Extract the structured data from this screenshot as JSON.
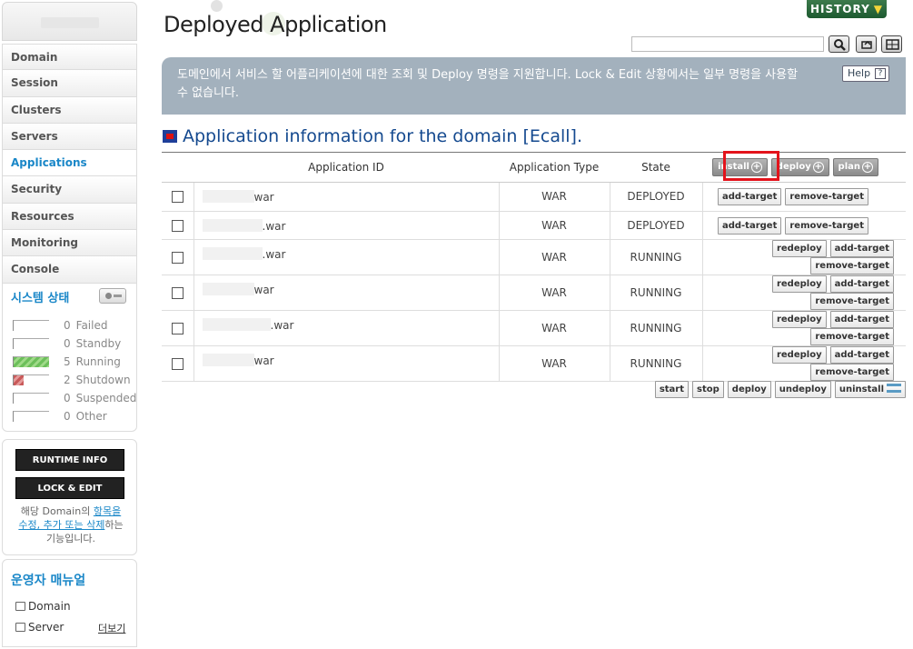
{
  "sidebar": {
    "nav": [
      {
        "label": "Domain",
        "active": false
      },
      {
        "label": "Session",
        "active": false
      },
      {
        "label": "Clusters",
        "active": false
      },
      {
        "label": "Servers",
        "active": false
      },
      {
        "label": "Applications",
        "active": true
      },
      {
        "label": "Security",
        "active": false
      },
      {
        "label": "Resources",
        "active": false
      },
      {
        "label": "Monitoring",
        "active": false
      },
      {
        "label": "Console",
        "active": false
      }
    ],
    "system_status": {
      "title": "시스템 상태",
      "rows": [
        {
          "count": "0",
          "label": "Failed",
          "fill_pct": 0,
          "color": ""
        },
        {
          "count": "0",
          "label": "Standby",
          "fill_pct": 0,
          "color": ""
        },
        {
          "count": "5",
          "label": "Running",
          "fill_pct": 100,
          "color": "green"
        },
        {
          "count": "2",
          "label": "Shutdown",
          "fill_pct": 28,
          "color": "red"
        },
        {
          "count": "0",
          "label": "Suspended",
          "fill_pct": 0,
          "color": ""
        },
        {
          "count": "0",
          "label": "Other",
          "fill_pct": 0,
          "color": ""
        }
      ]
    },
    "runtime_info_label": "RUNTIME INFO",
    "lock_edit_label": "LOCK & EDIT",
    "note": {
      "part1": "해당 Domain의 ",
      "link": "항목을 수정, 추가 또는 삭제",
      "part2": "하는 기능입니다."
    },
    "manual": {
      "title": "운영자 매뉴얼",
      "items": [
        "Domain",
        "Server"
      ],
      "more": "더보기"
    }
  },
  "header": {
    "title": "Deployed Application",
    "history_label": "HISTORY",
    "search_placeholder": ""
  },
  "banner": {
    "text": "도메인에서 서비스 할 어플리케이션에 대한 조회 및 Deploy 명령을 지원합니다. Lock & Edit 상황에서는 일부 명령을 사용할 수 없습니다.",
    "help_label": "Help",
    "help_q": "?"
  },
  "section": {
    "title": "Application information for the domain [Ecall]."
  },
  "table": {
    "headers": {
      "app_id": "Application ID",
      "app_type": "Application Type",
      "state": "State"
    },
    "header_buttons": {
      "install": "install",
      "deploy": "deploy",
      "plan": "plan"
    },
    "rows": [
      {
        "id_suffix": "war",
        "type": "WAR",
        "state": "DEPLOYED",
        "actions": [
          "add-target",
          "remove-target"
        ]
      },
      {
        "id_suffix": ".war",
        "type": "WAR",
        "state": "DEPLOYED",
        "actions": [
          "add-target",
          "remove-target"
        ]
      },
      {
        "id_suffix": ".war",
        "type": "WAR",
        "state": "RUNNING",
        "actions": [
          "redeploy",
          "add-target",
          "remove-target"
        ]
      },
      {
        "id_suffix": "war",
        "type": "WAR",
        "state": "RUNNING",
        "actions": [
          "redeploy",
          "add-target",
          "remove-target"
        ]
      },
      {
        "id_suffix": ".war",
        "type": "WAR",
        "state": "RUNNING",
        "actions": [
          "redeploy",
          "add-target",
          "remove-target"
        ]
      },
      {
        "id_suffix": "war",
        "type": "WAR",
        "state": "RUNNING",
        "actions": [
          "redeploy",
          "add-target",
          "remove-target"
        ]
      }
    ]
  },
  "bottom_actions": [
    "start",
    "stop",
    "deploy",
    "undeploy",
    "uninstall"
  ],
  "colors": {
    "accent": "#1a87c8",
    "title_blue": "#14498f",
    "banner": "#a3b1bd",
    "highlight": "#e3131b",
    "history_green": "#2e6b3e"
  }
}
